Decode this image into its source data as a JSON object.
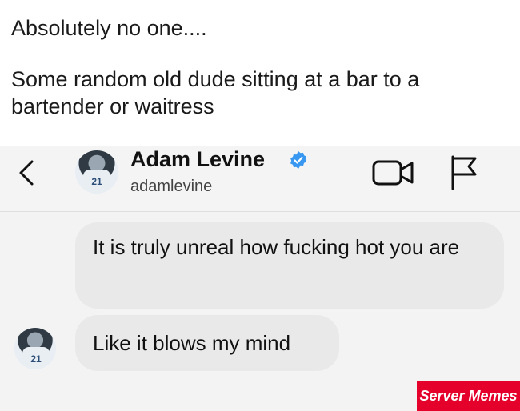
{
  "caption": {
    "line1": "Absolutely no one....",
    "line2": "Some random old dude sitting at a bar to a bartender or waitress"
  },
  "header": {
    "name": "Adam Levine",
    "handle": "adamlevine",
    "avatar_jersey_number": "21"
  },
  "messages": [
    {
      "text": "It is truly unreal how fucking hot you are"
    },
    {
      "text": "Like it blows my mind"
    }
  ],
  "watermark": {
    "text": "Server Memes"
  },
  "colors": {
    "verified": "#3897f0",
    "watermark_bg": "#e4002b"
  },
  "icons": [
    "back-arrow-icon",
    "verified-badge-icon",
    "video-call-icon",
    "flag-icon"
  ]
}
